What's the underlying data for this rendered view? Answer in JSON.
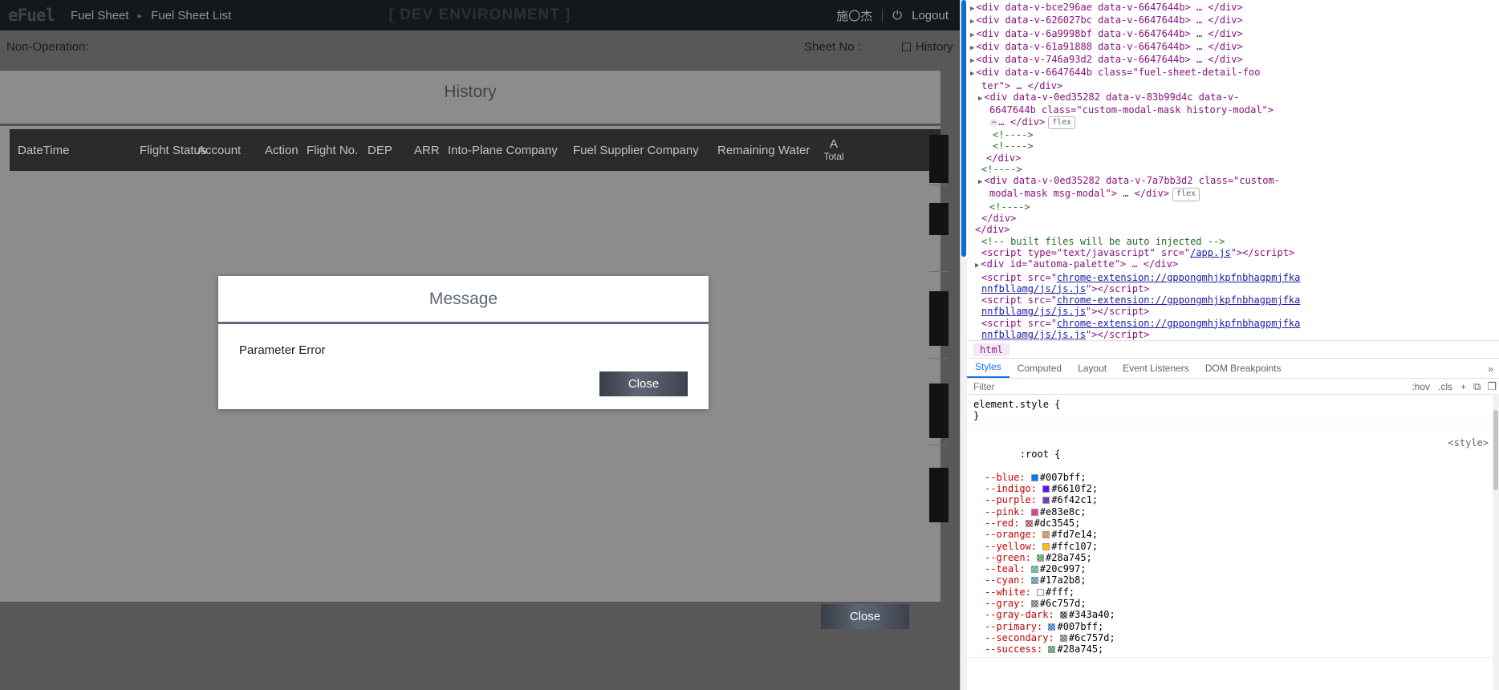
{
  "app": {
    "logo": "eFuel",
    "breadcrumb": [
      "Fuel Sheet",
      "Fuel Sheet List"
    ],
    "breadcrumb_sep": "▸",
    "env_banner": "[ DEV ENVIRONMENT ]",
    "user": "施〇杰",
    "logout": "Logout",
    "power_icon": "⏻"
  },
  "page": {
    "non_operation_label": "Non-Operation:",
    "sheet_no_label": "Sheet No :",
    "history_label": "History"
  },
  "history_modal": {
    "title": "History",
    "close_label": "Close",
    "columns": [
      "DateTime",
      "Flight Status",
      "Account",
      "Action",
      "Flight No.",
      "DEP",
      "ARR",
      "Into-Plane Company",
      "Fuel Supplier Company",
      "Remaining Water",
      "A",
      "Total"
    ]
  },
  "message_modal": {
    "title": "Message",
    "body": "Parameter Error",
    "close_label": "Close"
  },
  "devtools": {
    "breadcrumb": "html",
    "tabs": [
      "Styles",
      "Computed",
      "Layout",
      "Event Listeners",
      "DOM Breakpoints"
    ],
    "active_tab": "Styles",
    "more_tabs_icon": "»",
    "filter_placeholder": "Filter",
    "filter_value": "",
    "filter_hov": ":hov",
    "filter_cls": ".cls",
    "filter_plus": "+",
    "filter_newstyle_icon": "⧉",
    "filter_toggle_icon": "❐",
    "dom_lines": [
      "<div data-v-bce296ae data-v-6647644b> … </div>",
      "<div data-v-626027bc data-v-6647644b> … </div>",
      "<div data-v-6a9998bf data-v-6647644b> … </div>",
      "<div data-v-61a91888 data-v-6647644b> … </div>",
      "<div data-v-746a93d2 data-v-6647644b> … </div>"
    ],
    "footer_line_1": "<div data-v-6647644b class=\"fuel-sheet-detail-foo",
    "footer_line_2": "ter\"> … </div>",
    "history_line_1": "<div data-v-0ed35282 data-v-83b99d4c data-v-",
    "history_line_2": "6647644b class=\"custom-modal-mask history-modal\">",
    "history_line_3": "… </div>",
    "history_flex_badge": "flex",
    "comment_1": "<!---->",
    "comment_2": "<!---->",
    "close_div_1": "</div>",
    "comment_3": "<!---->",
    "msg_line_1": "<div data-v-0ed35282 data-v-7a7bb3d2 class=\"custom-",
    "msg_line_2": "modal-mask msg-modal\"> … </div>",
    "msg_flex_badge": "flex",
    "comment_4": "<!---->",
    "close_div_2": "</div>",
    "close_div_3": "</div>",
    "built_comment": "<!-- built files will be auto injected -->",
    "script_app_pre": "<script type=\"text/javascript\" src=\"",
    "script_app_href": "/app.js",
    "script_app_post": "\"></script>",
    "automa_line": "<div id=\"automa-palette\"> … </div>",
    "ext_pre": "<script src=\"",
    "ext_href_1": "chrome-extension://gppongmhjkpfnbhagpmjfka",
    "ext_href_2": "nnfbllamg/js/js.js",
    "ext_post": "\"></script>",
    "styles": {
      "element_style_sel": "element.style {",
      "element_style_end": "}",
      "root_sel": ":root {",
      "root_source": "<style>",
      "vars": [
        {
          "name": "--blue",
          "value": "#007bff;",
          "color": "#007bff",
          "checker": false
        },
        {
          "name": "--indigo",
          "value": "#6610f2;",
          "color": "#6610f2",
          "checker": false
        },
        {
          "name": "--purple",
          "value": "#6f42c1;",
          "color": "#6f42c1",
          "checker": false
        },
        {
          "name": "--pink",
          "value": "#e83e8c;",
          "color": "#e83e8c",
          "checker": false
        },
        {
          "name": "--red",
          "value": "#dc3545;",
          "color": "#dc3545",
          "checker": true
        },
        {
          "name": "--orange",
          "value": "#fd7e14;",
          "color": "#fd7e14",
          "checker": true
        },
        {
          "name": "--yellow",
          "value": "#ffc107;",
          "color": "#ffc107",
          "checker": false
        },
        {
          "name": "--green",
          "value": "#28a745;",
          "color": "#28a745",
          "checker": true
        },
        {
          "name": "--teal",
          "value": "#20c997;",
          "color": "#20c997",
          "checker": true
        },
        {
          "name": "--cyan",
          "value": "#17a2b8;",
          "color": "#17a2b8",
          "checker": true
        },
        {
          "name": "--white",
          "value": "#fff;",
          "color": "#ffffff",
          "checker": false
        },
        {
          "name": "--gray",
          "value": "#6c757d;",
          "color": "#6c757d",
          "checker": true
        },
        {
          "name": "--gray-dark",
          "value": "#343a40;",
          "color": "#343a40",
          "checker": true
        },
        {
          "name": "--primary",
          "value": "#007bff;",
          "color": "#007bff",
          "checker": true
        },
        {
          "name": "--secondary",
          "value": "#6c757d;",
          "color": "#6c757d",
          "checker": true
        },
        {
          "name": "--success",
          "value": "#28a745;",
          "color": "#28a745",
          "checker": true
        }
      ]
    }
  }
}
